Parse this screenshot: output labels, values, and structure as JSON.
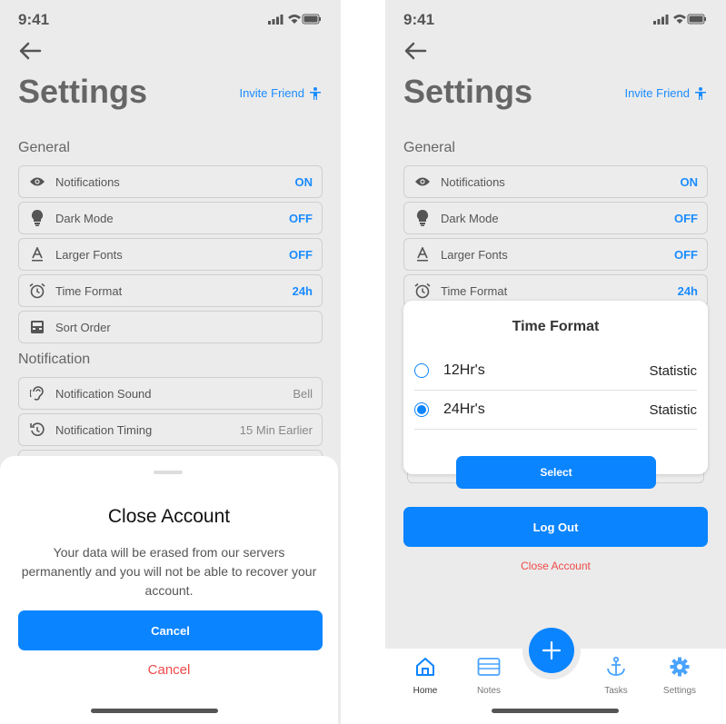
{
  "status": {
    "time": "9:41"
  },
  "header": {
    "title": "Settings",
    "invite_label": "Invite Friend"
  },
  "sections": {
    "general": "General",
    "notification": "Notification"
  },
  "general_items": [
    {
      "label": "Notifications",
      "value": "ON",
      "icon": "eye-icon"
    },
    {
      "label": "Dark Mode",
      "value": "OFF",
      "icon": "bulb-icon"
    },
    {
      "label": "Larger Fonts",
      "value": "OFF",
      "icon": "font-icon"
    },
    {
      "label": "Time Format",
      "value": "24h",
      "icon": "alarm-clock-icon"
    },
    {
      "label": "Sort Order",
      "value": "",
      "icon": "tray-icon"
    }
  ],
  "notification_items": [
    {
      "label": "Notification Sound",
      "value": "Bell",
      "icon": "ear-icon"
    },
    {
      "label": "Notification Timing",
      "value": "15 Min Earlier",
      "icon": "timer-icon"
    }
  ],
  "close_sheet": {
    "title": "Close Account",
    "message": "Your data will be erased from our servers permanently and you will not be able to recover your account.",
    "primary_label": "Cancel",
    "secondary_label": "Cancel"
  },
  "time_modal": {
    "title": "Time Format",
    "options": [
      {
        "label": "12Hr's",
        "value": "Statistic",
        "selected": false
      },
      {
        "label": "24Hr's",
        "value": "Statistic",
        "selected": true
      }
    ],
    "select_label": "Select"
  },
  "logout_label": "Log Out",
  "close_account_label": "Close Account",
  "tabs": [
    {
      "label": "Home",
      "icon": "home-icon",
      "active": true
    },
    {
      "label": "Notes",
      "icon": "notes-icon",
      "active": false
    },
    {
      "label": "Tasks",
      "icon": "anchor-icon",
      "active": false
    },
    {
      "label": "Settings",
      "icon": "gear-icon",
      "active": false
    }
  ],
  "colors": {
    "accent": "#0a84ff",
    "danger": "#f04a4a",
    "background": "#ebebeb"
  }
}
